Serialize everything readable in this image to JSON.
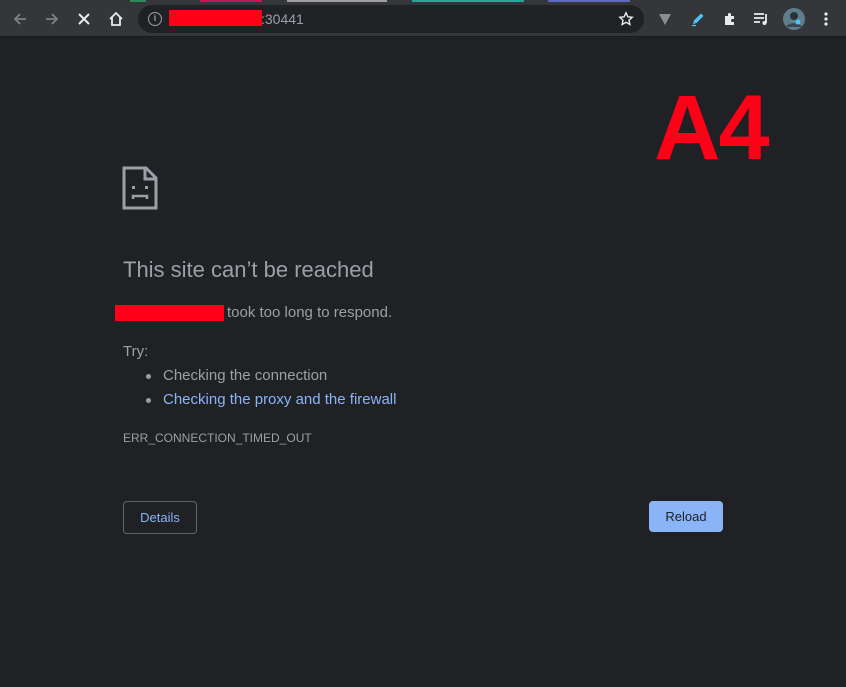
{
  "browser": {
    "url_visible_suffix": ":30441",
    "colors": {
      "toolbar_bg": "#35363a",
      "page_bg": "#202124",
      "link": "#8ab4f8",
      "annotation_red": "#ff0019"
    },
    "icons": [
      "back-arrow-icon",
      "forward-arrow-icon",
      "stop-loading-icon",
      "home-icon",
      "site-info-icon",
      "bookmark-star-icon",
      "extension-v-icon",
      "pen-extension-icon",
      "puzzle-extensions-icon",
      "media-queue-icon",
      "profile-avatar-icon",
      "kebab-menu-icon"
    ]
  },
  "page": {
    "annotation_label": "A4",
    "title": "This site can’t be reached",
    "message_suffix": "took too long to respond.",
    "try_label": "Try:",
    "suggestions": [
      "Checking the connection",
      "Checking the proxy and the firewall"
    ],
    "error_code": "ERR_CONNECTION_TIMED_OUT",
    "details_button": "Details",
    "reload_button": "Reload"
  }
}
